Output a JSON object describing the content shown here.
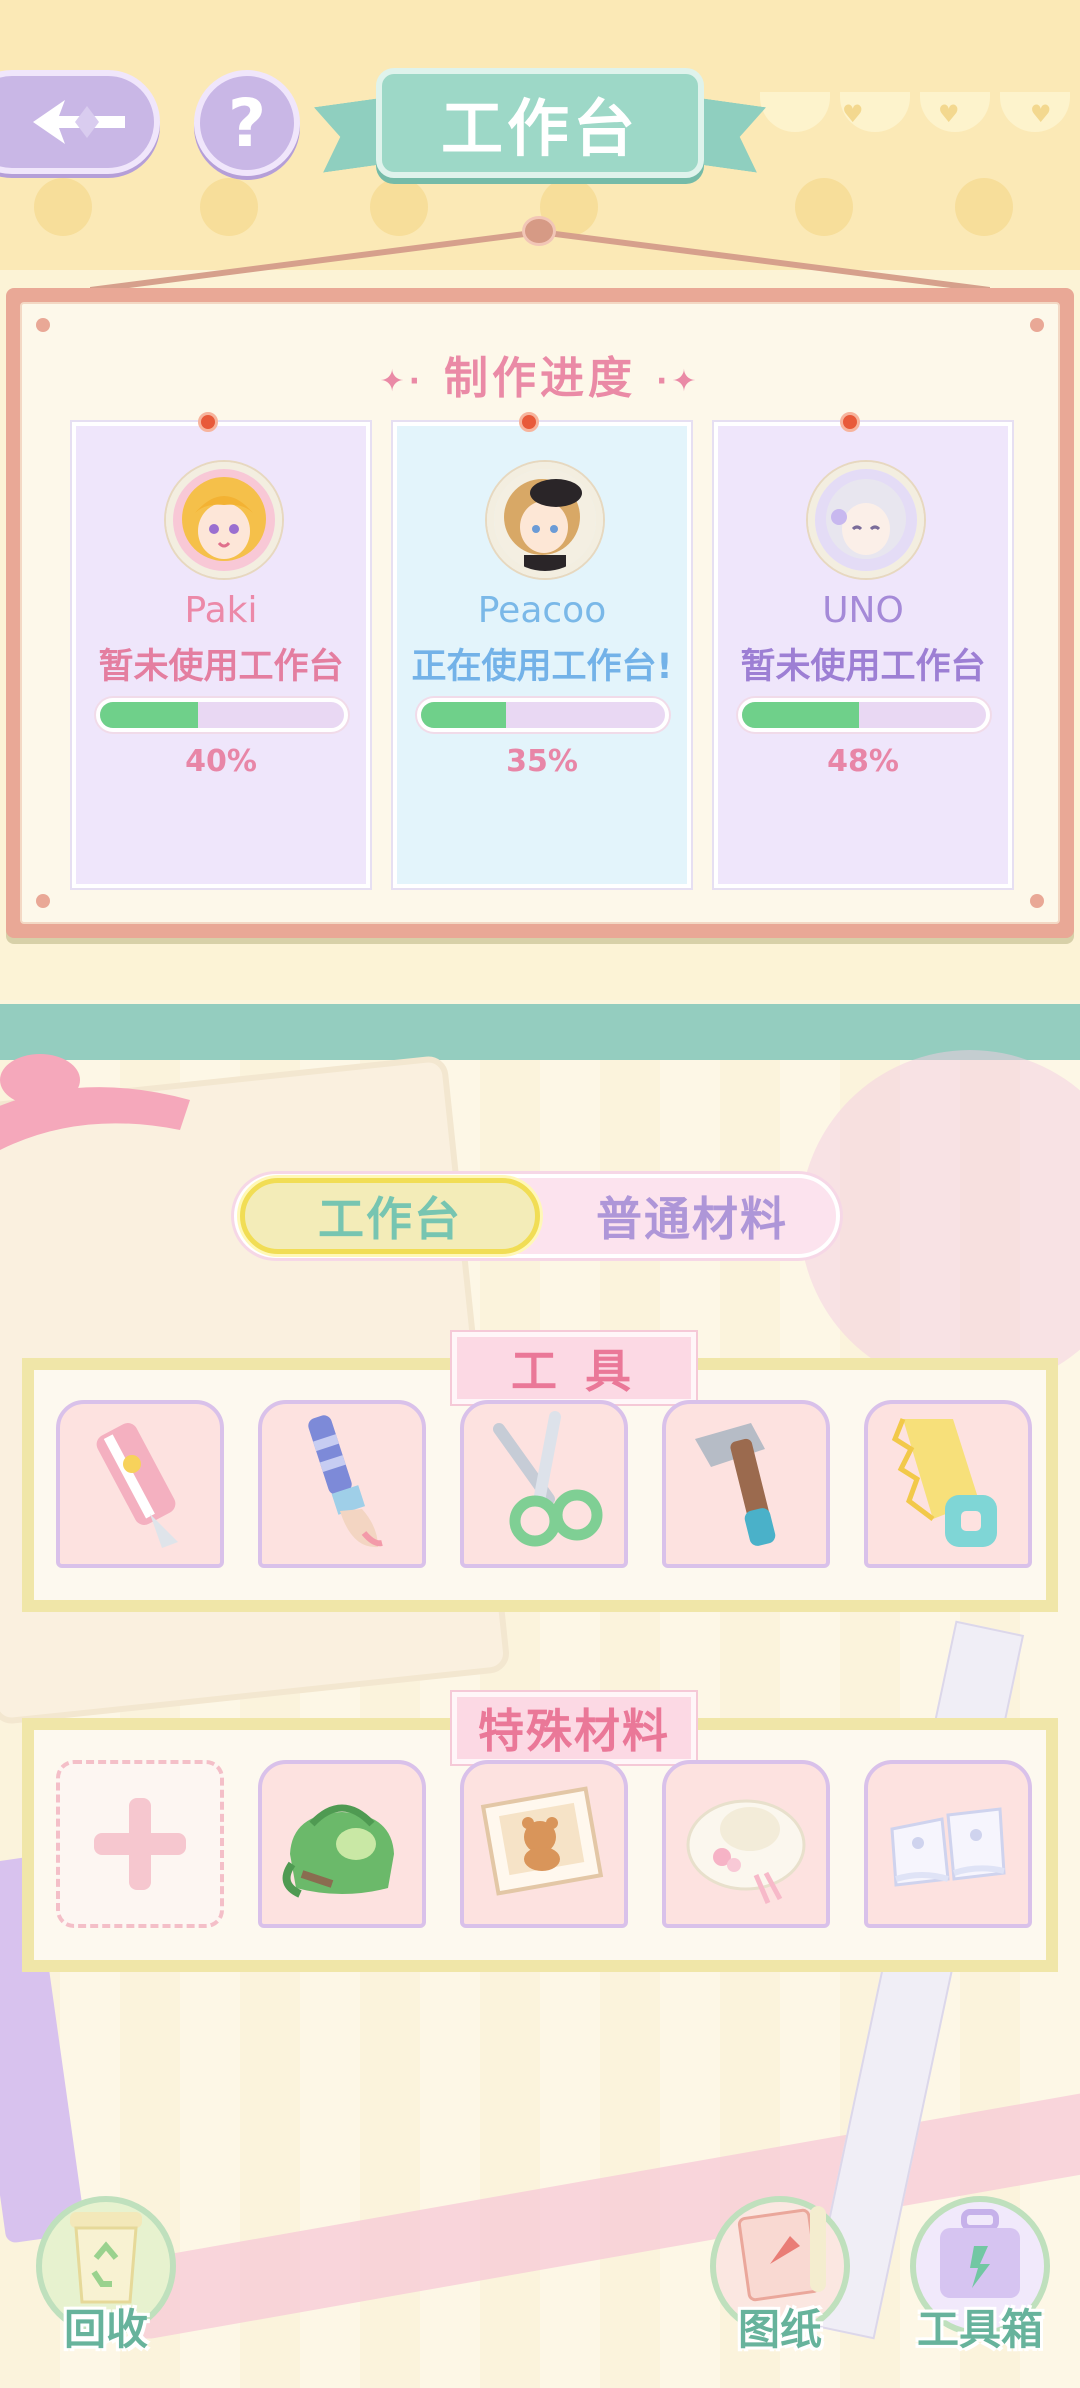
{
  "header": {
    "title": "工作台",
    "help_label": "?"
  },
  "progress_board": {
    "title": "制作进度",
    "characters": [
      {
        "name": "Paki",
        "status": "暂未使用工作台",
        "progress": 0.4,
        "progress_label": "40%",
        "name_color": "#ec89a8",
        "status_color": "#e47ea0",
        "card_tint": "lilac"
      },
      {
        "name": "Peacoo",
        "status": "正在使用工作台!",
        "progress": 0.35,
        "progress_label": "35%",
        "name_color": "#7ab8e8",
        "status_color": "#73b2e8",
        "card_tint": "blue"
      },
      {
        "name": "UNO",
        "status": "暂未使用工作台",
        "progress": 0.48,
        "progress_label": "48%",
        "name_color": "#a58ad8",
        "status_color": "#9d7fd4",
        "card_tint": "lilac"
      }
    ]
  },
  "tabs": {
    "active": "工作台",
    "inactive": "普通材料"
  },
  "tools_panel": {
    "label": "工 具",
    "items": [
      "box-cutter-icon",
      "paintbrush-icon",
      "scissors-icon",
      "hammer-icon",
      "saw-icon"
    ]
  },
  "special_panel": {
    "label": "特殊材料",
    "items": [
      "add-slot",
      "green-bag-icon",
      "bear-picture-icon",
      "flower-hat-icon",
      "lace-shoes-icon"
    ]
  },
  "bottom_nav": {
    "recycle": "回收",
    "blueprints": "图纸",
    "toolbox": "工具箱"
  },
  "colors": {
    "accent_teal": "#9dd8c7",
    "accent_pink": "#ea8aa6",
    "progress_fill": "#6fd08a",
    "tab_active_border": "#f1dd55"
  }
}
